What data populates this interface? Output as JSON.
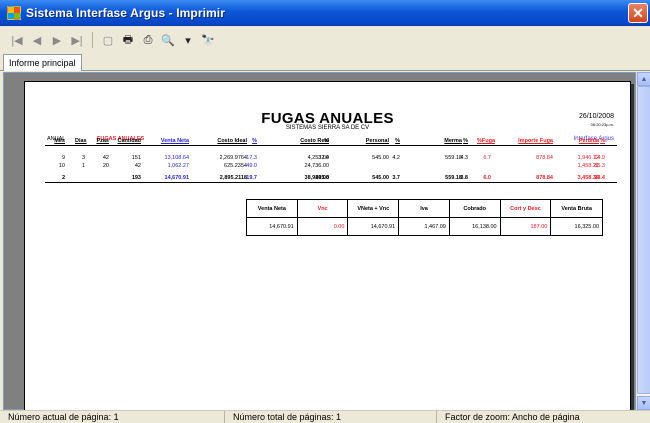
{
  "window": {
    "title": "Sistema Interfase Argus - Imprimir",
    "close_label": "✕"
  },
  "toolbar": {
    "first": "|◀",
    "prev": "◀",
    "next": "▶",
    "last": "▶|",
    "export": "▢",
    "print": "🖶",
    "setup": "⎙",
    "zoom": "🔍",
    "zoom_dropdown": "▾",
    "find": "🔭"
  },
  "tabs": {
    "main": "Informe principal"
  },
  "report": {
    "title": "FUGAS ANUALES",
    "subtitle": "SISTEMAS SIERRA SA DE CV",
    "date": "26/10/2008",
    "time": "06:20:23p.m.",
    "period_label": "ANUAL",
    "report_label": "FUGAS ANUALES",
    "company_label": "Interfase Argus",
    "columns": [
      "Mes",
      "Dias",
      "Pzas",
      "Cantidad",
      "Venta Neta",
      "Costo Ideal",
      "%",
      "Costo Real",
      "%",
      "Personal",
      "%",
      "Merma",
      "%",
      "%Fuga",
      "Importe Fuga",
      "Perdida",
      "%"
    ],
    "rows": [
      [
        "9",
        "3",
        "42",
        "151",
        "13,108.64",
        "2,269.9764",
        "17.3",
        "4,253.00",
        "32.4",
        "545.00",
        "4.2",
        "559.18",
        "4.3",
        "6.7",
        "878.84",
        "1,946.12",
        "14.9"
      ],
      [
        "10",
        "1",
        "20",
        "42",
        "1,062.27",
        "625.2354",
        "49.0",
        "24,736.00",
        "",
        "",
        "",
        "",
        "",
        "",
        "",
        "1,458.21",
        "85.3"
      ]
    ],
    "total": [
      "2",
      "",
      "",
      "193",
      "14,670.91",
      "2,895.2118",
      "19.7",
      "38,989.00",
      "265.8",
      "545.00",
      "3.7",
      "559.18",
      "3.8",
      "6.0",
      "878.84",
      "3,458.34",
      "23.4"
    ],
    "summary_headers": [
      "Venta Neta",
      "Vnc",
      "VNeta + Vnc",
      "Iva",
      "Cobrado",
      "Cort y Desc",
      "Venta Bruta"
    ],
    "summary_values": [
      "14,670.91",
      "0.00",
      "14,670.91",
      "1,467.09",
      "16,138.00",
      "187.00",
      "16,325.00"
    ]
  },
  "status": {
    "current_page": "Número actual de página: 1",
    "total_pages": "Número total de páginas: 1",
    "zoom": "Factor de zoom: Ancho de página"
  },
  "colors": {
    "title_bar": "#0a56d6",
    "accent_red": "#e8202a",
    "accent_blue": "#2424d8"
  }
}
